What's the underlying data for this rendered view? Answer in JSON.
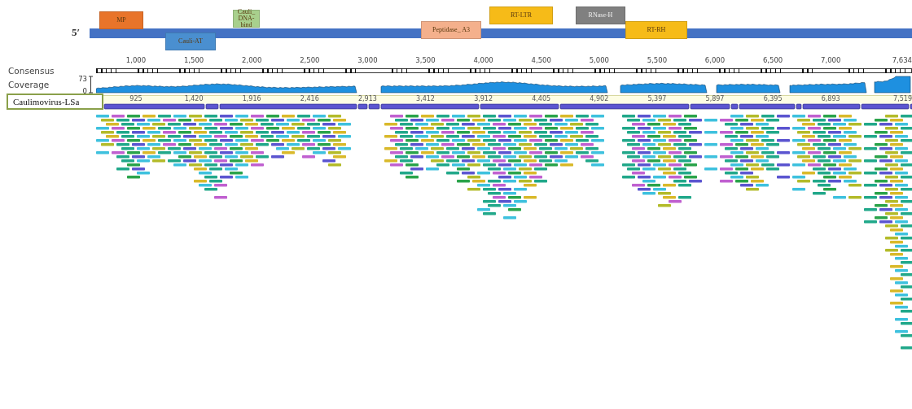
{
  "genome_map": {
    "end_label": "5′",
    "domains": [
      {
        "label": "MP",
        "color": "#e8742a"
      },
      {
        "label": "Cauli-AT",
        "color": "#4a8fd0"
      },
      {
        "label": "Cauli_ DNA-bind",
        "color": "#a8d08d"
      },
      {
        "label": "Peptidase_ A3",
        "color": "#f4b08c"
      },
      {
        "label": "RT-LTR",
        "color": "#f6bb18"
      },
      {
        "label": "RNase-H",
        "color": "#808080"
      },
      {
        "label": "RT-RH",
        "color": "#f6bb18"
      }
    ]
  },
  "ruler": {
    "ticks": [
      "1,000",
      "1,500",
      "2,000",
      "2,500",
      "3,000",
      "3,500",
      "4,000",
      "4,500",
      "5,000",
      "5,500",
      "6,000",
      "6,500",
      "7,000",
      "7,634"
    ]
  },
  "tracks": {
    "consensus_label": "Consensus",
    "coverage_label": "Coverage",
    "coverage_max": "73",
    "coverage_min": "0"
  },
  "reference": {
    "name": "Caulimovirus-LSa",
    "ticks": [
      "925",
      "1,420",
      "1,916",
      "2,416",
      "2,913",
      "3,412",
      "3,912",
      "4,405",
      "4,902",
      "5,397",
      "5,897",
      "6,395",
      "6,893",
      "7,519"
    ]
  }
}
